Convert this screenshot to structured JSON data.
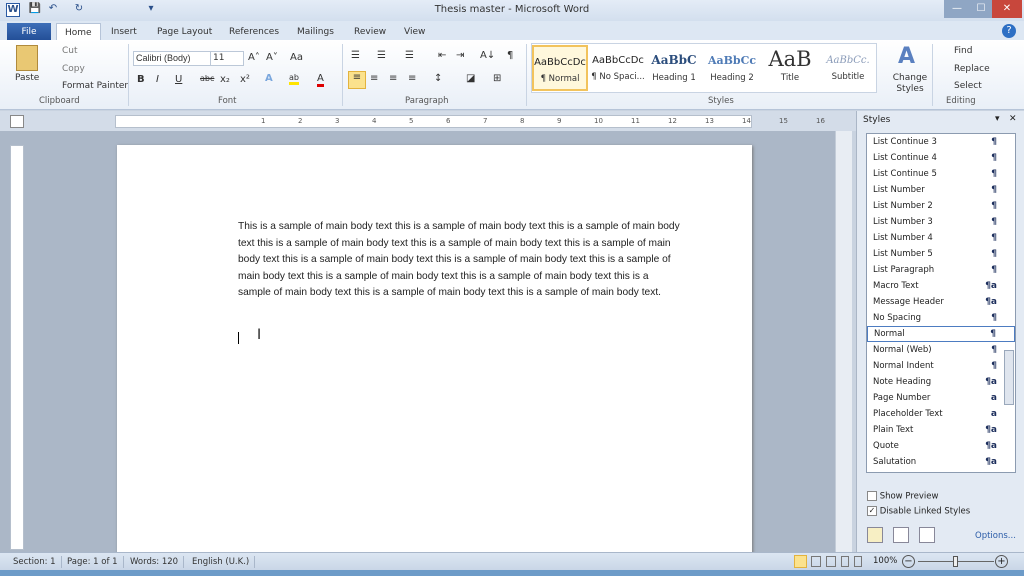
{
  "window": {
    "title": "Thesis master - Microsoft Word",
    "minimize": "—",
    "maximize": "☐",
    "close": "✕"
  },
  "quick_access": {
    "word_icon": "W",
    "save": "💾",
    "undo": "↶",
    "redo": "↻",
    "more": "▾"
  },
  "tabs": {
    "file": "File",
    "items": [
      "Home",
      "Insert",
      "Page Layout",
      "References",
      "Mailings",
      "Review",
      "View"
    ]
  },
  "ribbon": {
    "clipboard": {
      "paste": "Paste",
      "cut": "Cut",
      "copy": "Copy",
      "format_painter": "Format Painter",
      "label": "Clipboard"
    },
    "font": {
      "name": "Calibri (Body)",
      "size": "11",
      "grow": "A˄",
      "shrink": "A˅",
      "change_case": "Aa",
      "bold": "B",
      "italic": "I",
      "underline": "U",
      "strike": "abc",
      "sub": "x₂",
      "sup": "x²",
      "effects": "A",
      "highlight": "ab",
      "color": "A",
      "label": "Font"
    },
    "paragraph": {
      "bullets": "☰",
      "numbering": "☰",
      "multilevel": "☰",
      "dec_indent": "⇤",
      "inc_indent": "⇥",
      "sort": "A↓",
      "show": "¶",
      "left": "≡",
      "center": "≡",
      "right": "≡",
      "justify": "≡",
      "spacing": "↕",
      "shading": "◪",
      "borders": "⊞",
      "label": "Paragraph"
    },
    "styles": {
      "items": [
        {
          "sample": "AaBbCcDc",
          "name": "¶ Normal"
        },
        {
          "sample": "AaBbCcDc",
          "name": "¶ No Spaci..."
        },
        {
          "sample": "AaBbC",
          "name": "Heading 1"
        },
        {
          "sample": "AaBbCc",
          "name": "Heading 2"
        },
        {
          "sample": "AaB",
          "name": "Title"
        },
        {
          "sample": "AaBbCc.",
          "name": "Subtitle"
        }
      ],
      "change_styles": "Change Styles",
      "label": "Styles"
    },
    "editing": {
      "find": "Find",
      "replace": "Replace",
      "select": "Select",
      "label": "Editing"
    }
  },
  "ruler": {
    "numbers": [
      "1",
      "2",
      "3",
      "4",
      "5",
      "6",
      "7",
      "8",
      "9",
      "10",
      "11",
      "12",
      "13",
      "14",
      "15",
      "16"
    ]
  },
  "document": {
    "body": "This is a sample of main body text this is a sample of main body text this is a sample of main body text this is a sample of main body text this is a sample of main body text this is a sample of main body text this is a sample of main body text this is a sample of main body text this is a sample of main body text this is a sample of main body text this is a sample of main body text this is a sample of main body text this is a sample of main body text this is a sample of main body text."
  },
  "styles_pane": {
    "title": "Styles",
    "items": [
      {
        "name": "List Continue 3",
        "glyph": "¶"
      },
      {
        "name": "List Continue 4",
        "glyph": "¶"
      },
      {
        "name": "List Continue 5",
        "glyph": "¶"
      },
      {
        "name": "List Number",
        "glyph": "¶"
      },
      {
        "name": "List Number 2",
        "glyph": "¶"
      },
      {
        "name": "List Number 3",
        "glyph": "¶"
      },
      {
        "name": "List Number 4",
        "glyph": "¶"
      },
      {
        "name": "List Number 5",
        "glyph": "¶"
      },
      {
        "name": "List Paragraph",
        "glyph": "¶"
      },
      {
        "name": "Macro Text",
        "glyph": "¶a"
      },
      {
        "name": "Message Header",
        "glyph": "¶a"
      },
      {
        "name": "No Spacing",
        "glyph": "¶"
      },
      {
        "name": "Normal",
        "glyph": "¶",
        "selected": true
      },
      {
        "name": "Normal (Web)",
        "glyph": "¶"
      },
      {
        "name": "Normal Indent",
        "glyph": "¶"
      },
      {
        "name": "Note Heading",
        "glyph": "¶a"
      },
      {
        "name": "Page Number",
        "glyph": "a"
      },
      {
        "name": "Placeholder Text",
        "glyph": "a"
      },
      {
        "name": "Plain Text",
        "glyph": "¶a"
      },
      {
        "name": "Quote",
        "glyph": "¶a"
      },
      {
        "name": "Salutation",
        "glyph": "¶a"
      }
    ],
    "show_preview": "Show Preview",
    "show_preview_checked": false,
    "disable_linked": "Disable Linked Styles",
    "disable_linked_checked": true,
    "options": "Options..."
  },
  "status": {
    "section": "Section: 1",
    "page": "Page: 1 of 1",
    "words": "Words: 120",
    "language": "English (U.K.)",
    "zoom": "100%",
    "zoom_minus": "−",
    "zoom_plus": "+"
  },
  "colors": {
    "accent": "#2b579a",
    "file_tab": "#2a5aa3"
  }
}
